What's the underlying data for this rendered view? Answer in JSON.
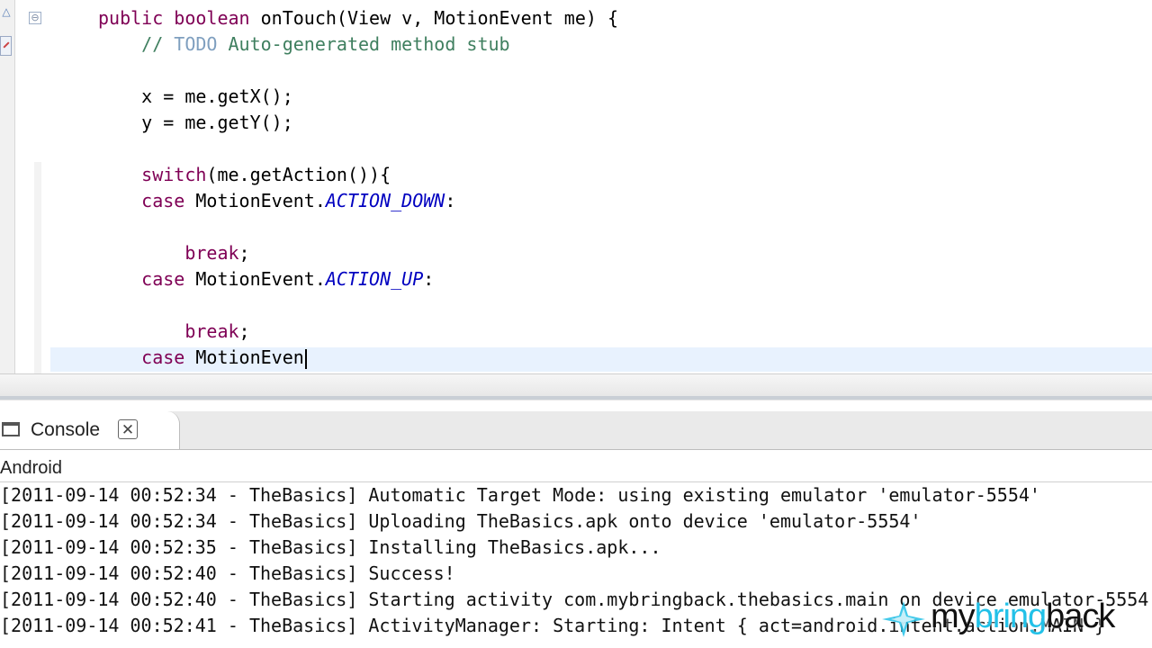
{
  "editor": {
    "lines": [
      {
        "segments": [
          {
            "t": "public",
            "c": "kw"
          },
          {
            "t": " "
          },
          {
            "t": "boolean",
            "c": "kw"
          },
          {
            "t": " onTouch(View v, MotionEvent me) {"
          }
        ]
      },
      {
        "segments": [
          {
            "t": "    "
          },
          {
            "t": "// ",
            "c": "cm"
          },
          {
            "t": "TODO",
            "c": "todo"
          },
          {
            "t": " Auto-generated method stub",
            "c": "cm"
          }
        ]
      },
      {
        "segments": []
      },
      {
        "segments": [
          {
            "t": "    x = me.getX();"
          }
        ]
      },
      {
        "segments": [
          {
            "t": "    y = me.getY();"
          }
        ]
      },
      {
        "segments": []
      },
      {
        "segments": [
          {
            "t": "    "
          },
          {
            "t": "switch",
            "c": "kw"
          },
          {
            "t": "(me.getAction()){"
          }
        ]
      },
      {
        "segments": [
          {
            "t": "    "
          },
          {
            "t": "case",
            "c": "kw"
          },
          {
            "t": " MotionEvent."
          },
          {
            "t": "ACTION_DOWN",
            "c": "fld"
          },
          {
            "t": ":"
          }
        ]
      },
      {
        "segments": []
      },
      {
        "segments": [
          {
            "t": "        "
          },
          {
            "t": "break",
            "c": "kw"
          },
          {
            "t": ";"
          }
        ]
      },
      {
        "segments": [
          {
            "t": "    "
          },
          {
            "t": "case",
            "c": "kw"
          },
          {
            "t": " MotionEvent."
          },
          {
            "t": "ACTION_UP",
            "c": "fld"
          },
          {
            "t": ":"
          }
        ]
      },
      {
        "segments": []
      },
      {
        "segments": [
          {
            "t": "        "
          },
          {
            "t": "break",
            "c": "kw"
          },
          {
            "t": ";"
          }
        ]
      },
      {
        "segments": [
          {
            "t": "    "
          },
          {
            "t": "case",
            "c": "kw"
          },
          {
            "t": " MotionEven"
          }
        ],
        "caret": true
      }
    ],
    "fold_glyph": "⊖",
    "gutter_arrow": "△"
  },
  "console": {
    "tab_label": "Console",
    "tab_close": "✕",
    "source_label": "Android",
    "log_lines": [
      "[2011-09-14 00:52:34 - TheBasics] Automatic Target Mode: using existing emulator 'emulator-5554'",
      "[2011-09-14 00:52:34 - TheBasics] Uploading TheBasics.apk onto device 'emulator-5554'",
      "[2011-09-14 00:52:35 - TheBasics] Installing TheBasics.apk...",
      "[2011-09-14 00:52:40 - TheBasics] Success!",
      "[2011-09-14 00:52:40 - TheBasics] Starting activity com.mybringback.thebasics.main on device emulator-5554",
      "[2011-09-14 00:52:41 - TheBasics] ActivityManager: Starting: Intent { act=android.intent.action.MAIN }"
    ]
  },
  "watermark": {
    "part1": "my",
    "part2": "bring",
    "part3": "back"
  },
  "colors": {
    "keyword": "#7f0055",
    "comment": "#3f7f5f",
    "todo": "#7f9fbf",
    "static_field": "#0000c0",
    "current_line": "#e8f2fe",
    "brand_accent": "#22c1e8"
  }
}
